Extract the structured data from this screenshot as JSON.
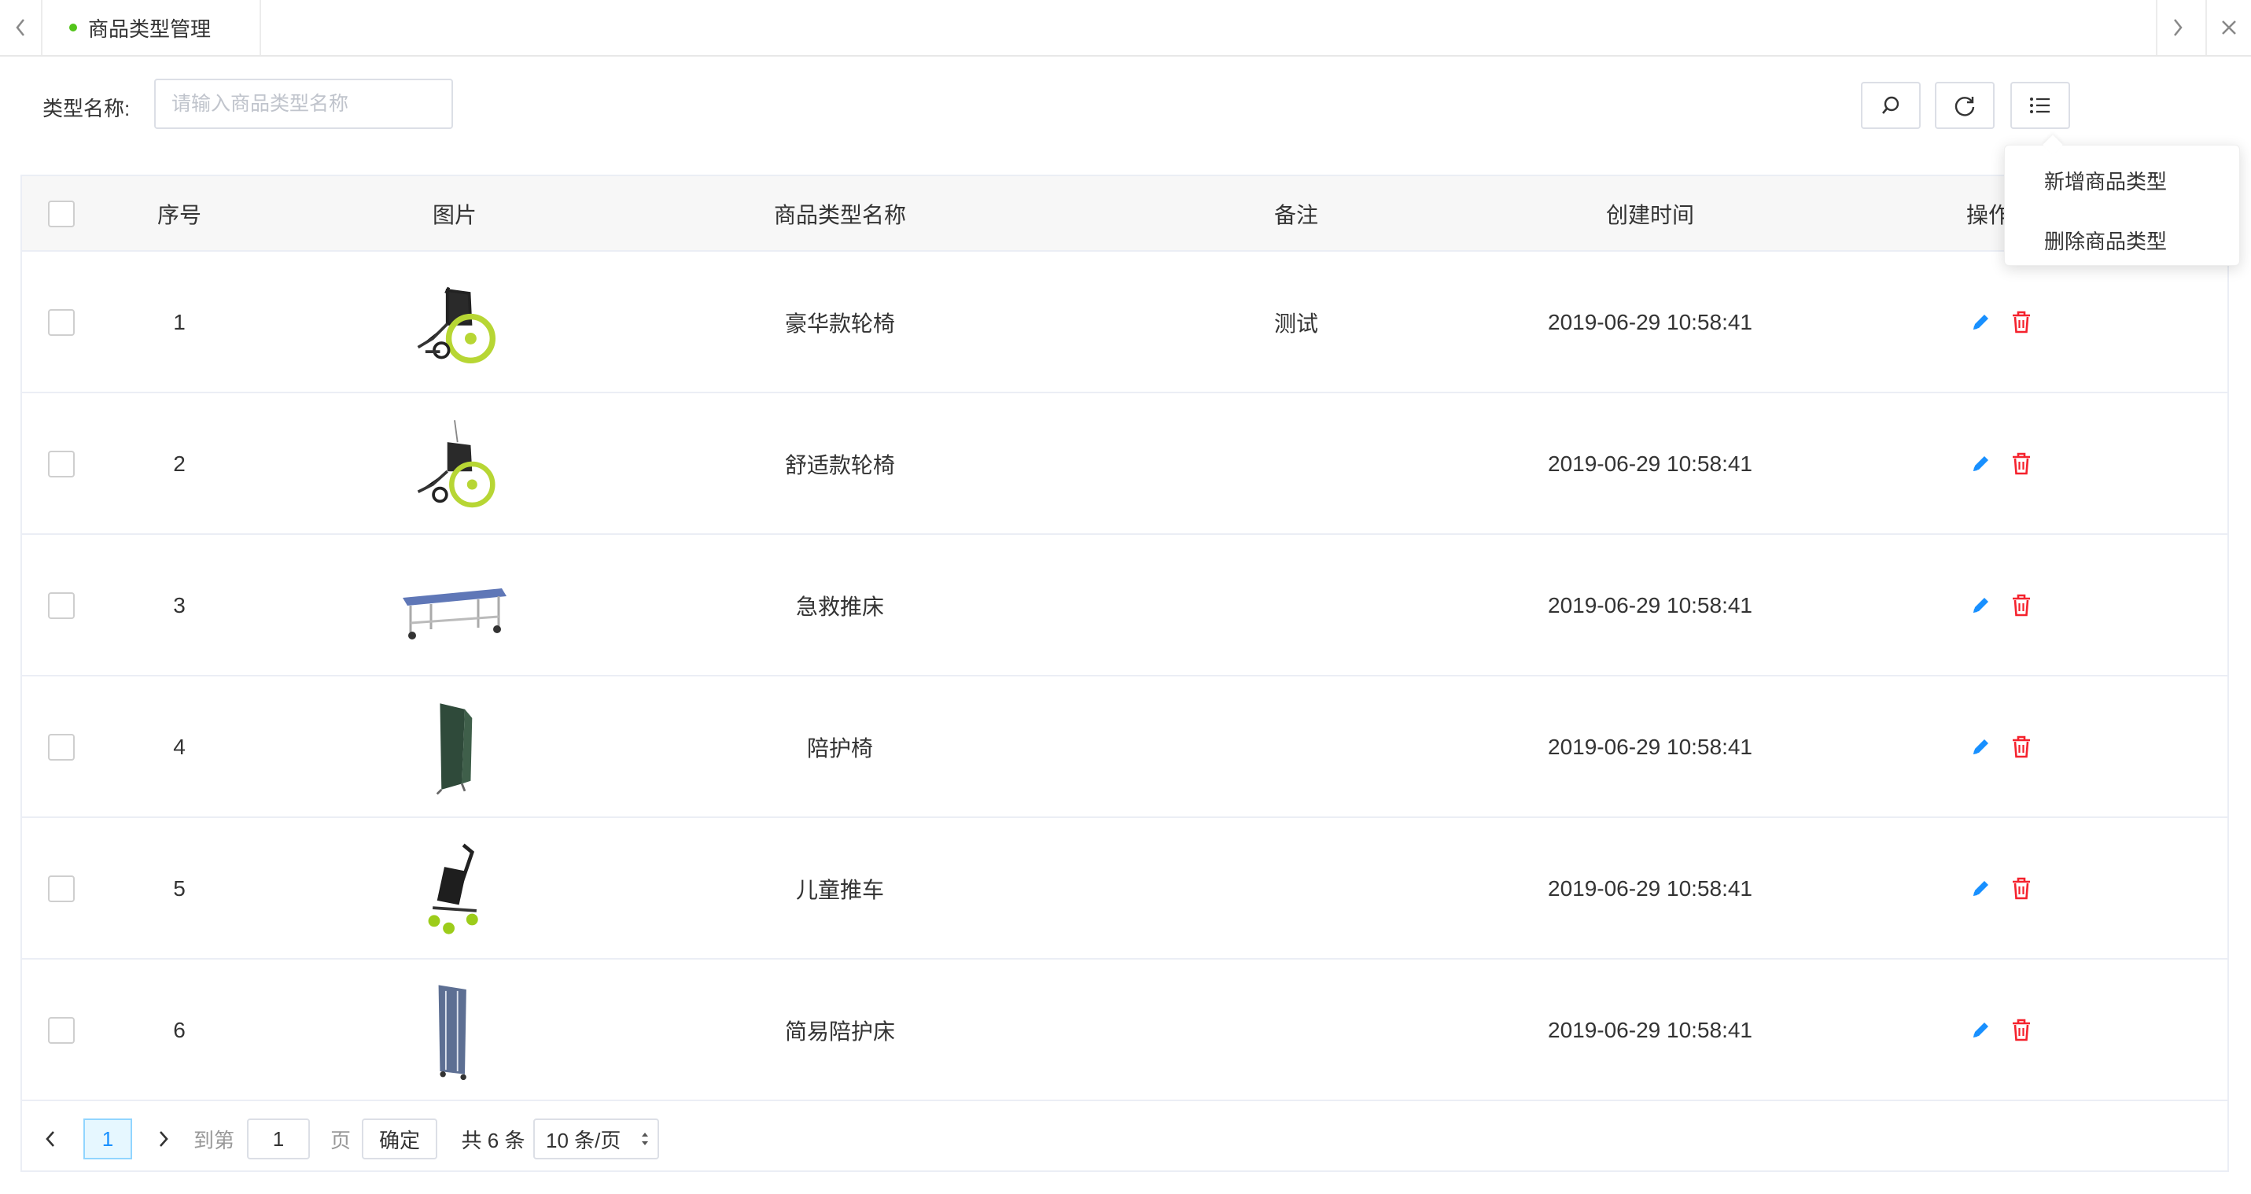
{
  "tabs": {
    "active_tab": "商品类型管理",
    "prev_icon": "chevron-left-icon",
    "next_icon": "chevron-right-icon",
    "close_icon": "close-icon"
  },
  "search": {
    "label": "类型名称:",
    "placeholder": "请输入商品类型名称",
    "value": ""
  },
  "toolbar": {
    "search_icon": "search-icon",
    "refresh_icon": "refresh-icon",
    "menu_icon": "list-menu-icon"
  },
  "dropdown": {
    "items": [
      {
        "label": "新增商品类型"
      },
      {
        "label": "删除商品类型"
      }
    ]
  },
  "table": {
    "headers": {
      "index": "序号",
      "image": "图片",
      "name": "商品类型名称",
      "remark": "备注",
      "created": "创建时间",
      "action": "操作"
    },
    "rows": [
      {
        "index": "1",
        "image": "wheelchair-luxury",
        "name": "豪华款轮椅",
        "remark": "测试",
        "created": "2019-06-29 10:58:41"
      },
      {
        "index": "2",
        "image": "wheelchair-comfort",
        "name": "舒适款轮椅",
        "remark": "",
        "created": "2019-06-29 10:58:41"
      },
      {
        "index": "3",
        "image": "stretcher",
        "name": "急救推床",
        "remark": "",
        "created": "2019-06-29 10:58:41"
      },
      {
        "index": "4",
        "image": "folding-chair",
        "name": "陪护椅",
        "remark": "",
        "created": "2019-06-29 10:58:41"
      },
      {
        "index": "5",
        "image": "stroller",
        "name": "儿童推车",
        "remark": "",
        "created": "2019-06-29 10:58:41"
      },
      {
        "index": "6",
        "image": "folding-bed",
        "name": "简易陪护床",
        "remark": "",
        "created": "2019-06-29 10:58:41"
      }
    ],
    "row_actions": {
      "edit_icon": "edit-icon",
      "delete_icon": "delete-icon"
    }
  },
  "pagination": {
    "current_page": "1",
    "goto_label": "到第",
    "goto_value": "1",
    "page_unit": "页",
    "confirm_label": "确定",
    "total_label": "共 6 条",
    "page_size": "10 条/页"
  },
  "colors": {
    "accent_blue": "#1890ff",
    "delete_red": "#f5222d",
    "active_dot": "#52c41a"
  }
}
